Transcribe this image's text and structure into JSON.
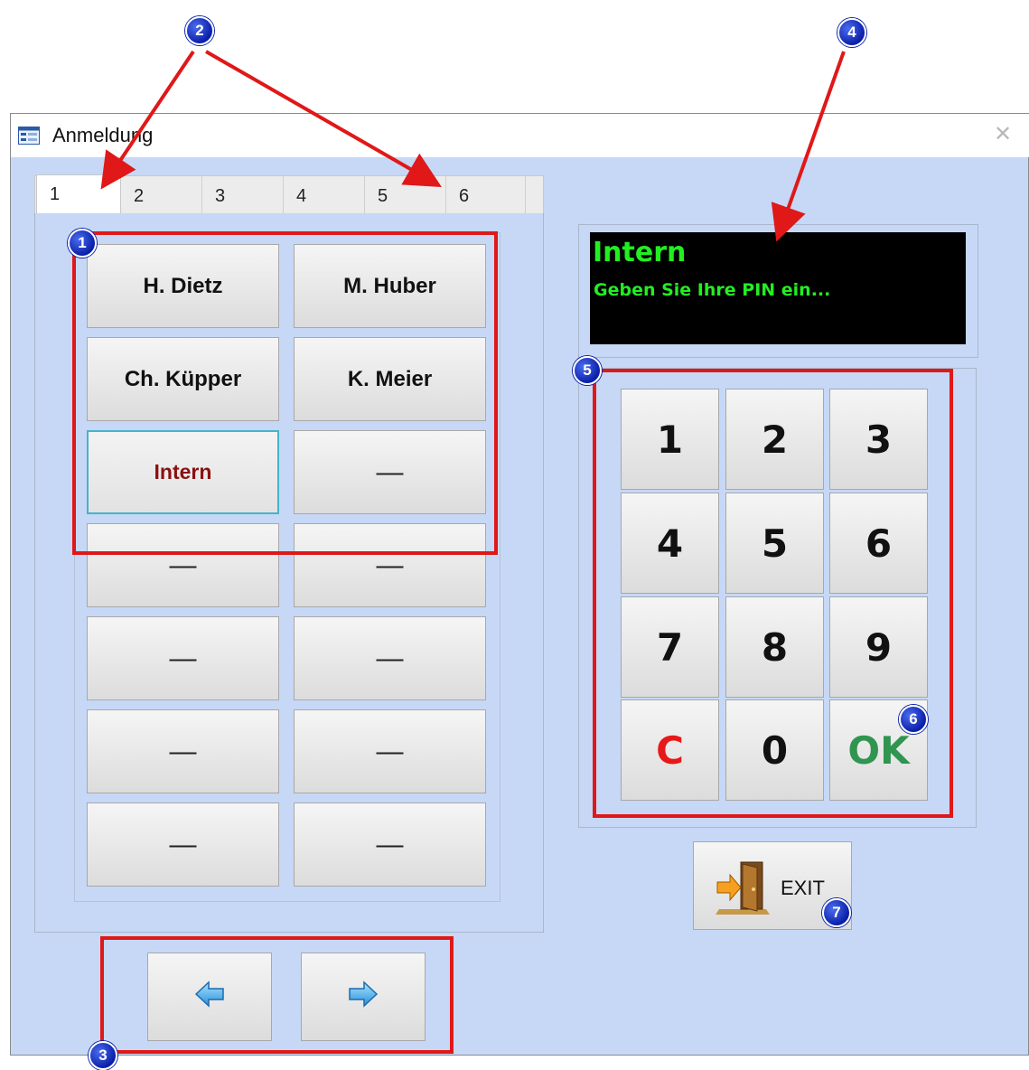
{
  "window": {
    "title": "Anmeldung",
    "close_glyph": "✕"
  },
  "tabs": [
    "1",
    "2",
    "3",
    "4",
    "5",
    "6"
  ],
  "active_tab": "1",
  "user_buttons": [
    "H. Dietz",
    "M. Huber",
    "Ch. Küpper",
    "K. Meier",
    "Intern",
    "—",
    "—",
    "—",
    "—",
    "—",
    "—",
    "—",
    "—",
    "—"
  ],
  "selected_user": "Intern",
  "display": {
    "line1": "Intern",
    "line2": "Geben Sie Ihre PIN ein..."
  },
  "keypad": [
    "1",
    "2",
    "3",
    "4",
    "5",
    "6",
    "7",
    "8",
    "9",
    "C",
    "0",
    "OK"
  ],
  "exit_label": "EXIT",
  "nav": {
    "prev_icon": "arrow-left-icon",
    "next_icon": "arrow-right-icon"
  },
  "annotations": [
    "1",
    "2",
    "3",
    "4",
    "5",
    "6",
    "7"
  ],
  "colors": {
    "window_bg": "#c6d8f5",
    "display_bg": "#000000",
    "display_text": "#22ee22",
    "selected_text": "#8b1010",
    "clear_key": "#e81818",
    "ok_key": "#2f9550",
    "annotation_red": "#e01818",
    "badge_blue": "#0a1fa8"
  }
}
